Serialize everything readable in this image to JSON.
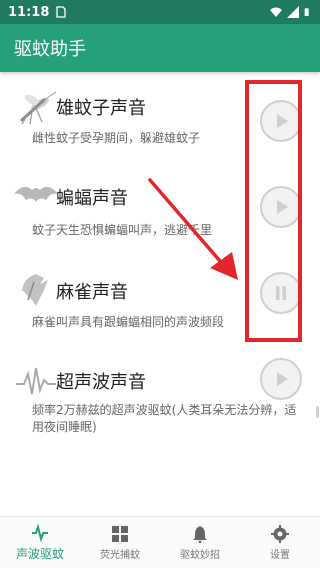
{
  "status_bar": {
    "time": "11:18"
  },
  "app": {
    "title": "驱蚊助手"
  },
  "items": [
    {
      "title": "雄蚊子声音",
      "desc": "雌性蚊子受孕期间，躲避雄蚊子",
      "icon": "mosquito-icon",
      "state": "play"
    },
    {
      "title": "蝙蝠声音",
      "desc": "蚊子天生恐惧蝙蝠叫声，逃避千里",
      "icon": "bat-icon",
      "state": "play"
    },
    {
      "title": "麻雀声音",
      "desc": "麻雀叫声具有跟蝙蝠相同的声波频段",
      "icon": "sparrow-icon",
      "state": "pause"
    },
    {
      "title": "超声波声音",
      "desc": "频率2万赫兹的超声波驱蚊(人类耳朵无法分辨，适用夜间睡眠)",
      "icon": "waveform-icon",
      "state": "play"
    }
  ],
  "bottom_nav": [
    {
      "label": "声波驱蚊",
      "icon": "pulse-icon",
      "active": true
    },
    {
      "label": "荧光捕蚊",
      "icon": "grid-icon",
      "active": false
    },
    {
      "label": "驱蚊妙招",
      "icon": "bell-icon",
      "active": false
    },
    {
      "label": "设置",
      "icon": "gear-icon",
      "active": false
    }
  ],
  "colors": {
    "status_bar": "#1f7a5f",
    "app_bar": "#26a07a",
    "highlight": "#e3262b"
  }
}
